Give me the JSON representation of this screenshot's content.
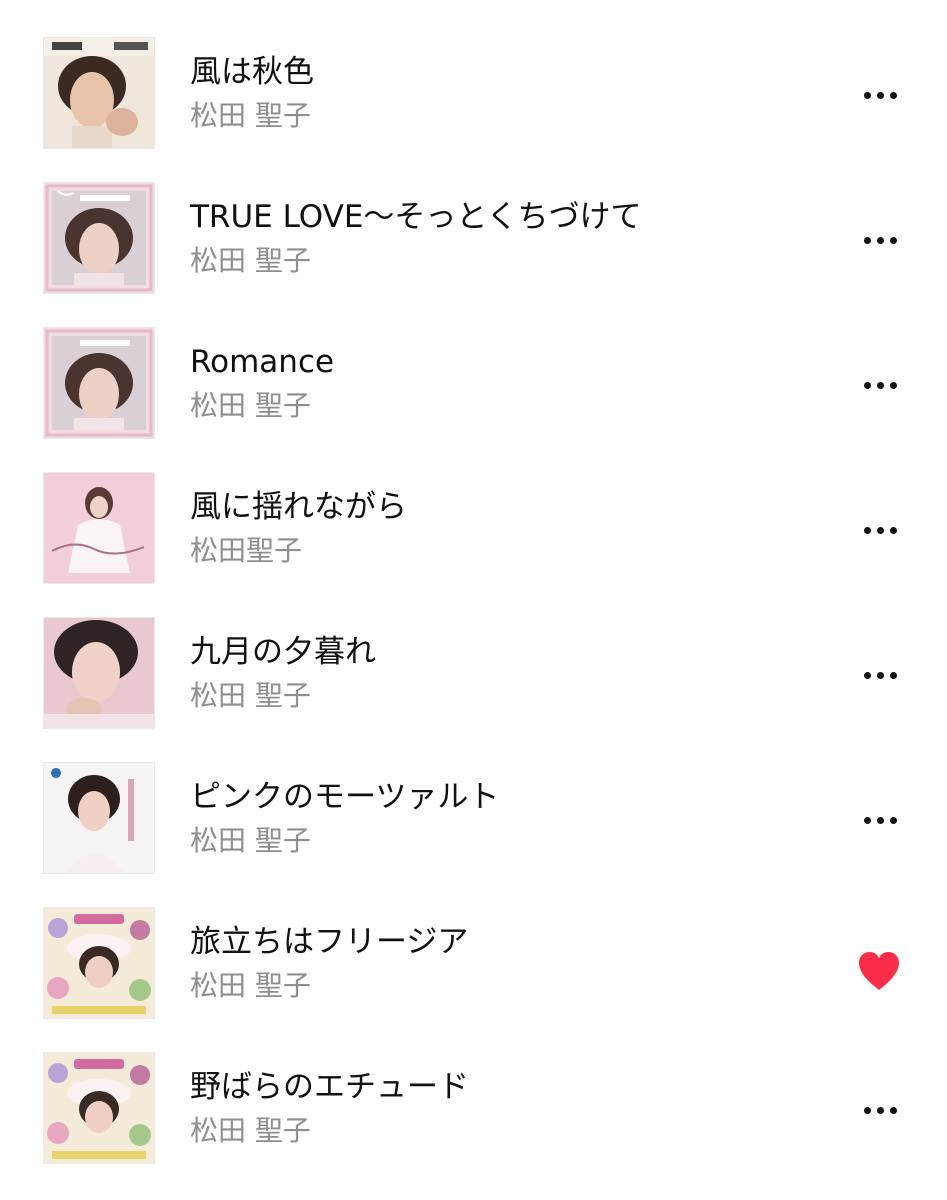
{
  "songs": [
    {
      "title": "風は秋色",
      "artist": "松田 聖子",
      "art": "album-cover-kaze-wa-akiiro",
      "action": "more-icon"
    },
    {
      "title": "TRUE LOVE～そっとくちづけて",
      "artist": "松田 聖子",
      "art": "album-cover-seiko-sweet-days",
      "action": "more-icon"
    },
    {
      "title": "Romance",
      "artist": "松田 聖子",
      "art": "album-cover-seiko-sweet-days",
      "action": "more-icon"
    },
    {
      "title": "風に揺れながら",
      "artist": "松田聖子",
      "art": "album-cover-my-prelude",
      "action": "more-icon"
    },
    {
      "title": "九月の夕暮れ",
      "artist": "松田 聖子",
      "art": "album-cover-portrait-pink",
      "action": "more-icon"
    },
    {
      "title": "ピンクのモーツァルト",
      "artist": "松田 聖子",
      "art": "album-cover-pink-no-mozart",
      "action": "more-icon"
    },
    {
      "title": "旅立ちはフリージア",
      "artist": "松田 聖子",
      "art": "album-cover-seiko-story",
      "action": "heart-icon"
    },
    {
      "title": "野ばらのエチュード",
      "artist": "松田 聖子",
      "art": "album-cover-seiko-story",
      "action": "more-icon"
    }
  ],
  "colors": {
    "artist_text": "#8e8e93",
    "heart": "#fa2d48",
    "more_dots": "#111111"
  }
}
